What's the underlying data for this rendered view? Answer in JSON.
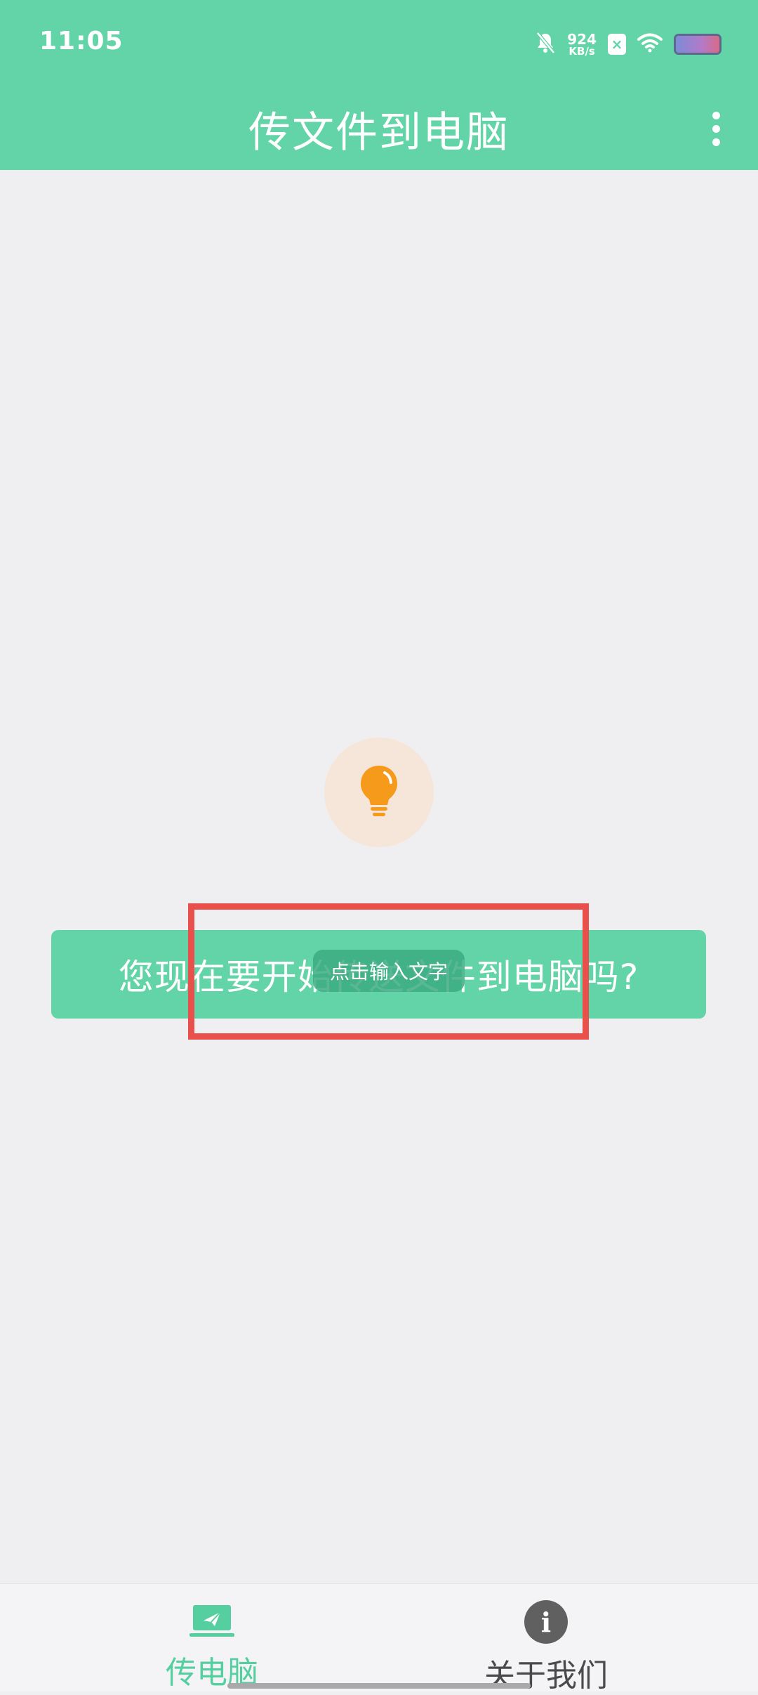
{
  "status_bar": {
    "time": "11:05",
    "net_speed_value": "924",
    "net_speed_unit": "KB/s",
    "sim_badge": "×",
    "battery_level": 1.0
  },
  "app_bar": {
    "title": "传文件到电脑",
    "background_color": "#62d4a7"
  },
  "main": {
    "icon": "lightbulb-icon",
    "start_prompt": "您现在要开始传送文件到电脑吗?",
    "tooltip": "点击输入文字"
  },
  "bottom_nav": {
    "items": [
      {
        "label": "传电脑",
        "icon": "send-to-computer-icon",
        "active": true
      },
      {
        "label": "关于我们",
        "icon": "info-icon",
        "active": false
      }
    ],
    "active_color": "#55cfa0"
  },
  "highlight_color": "#e9504b"
}
